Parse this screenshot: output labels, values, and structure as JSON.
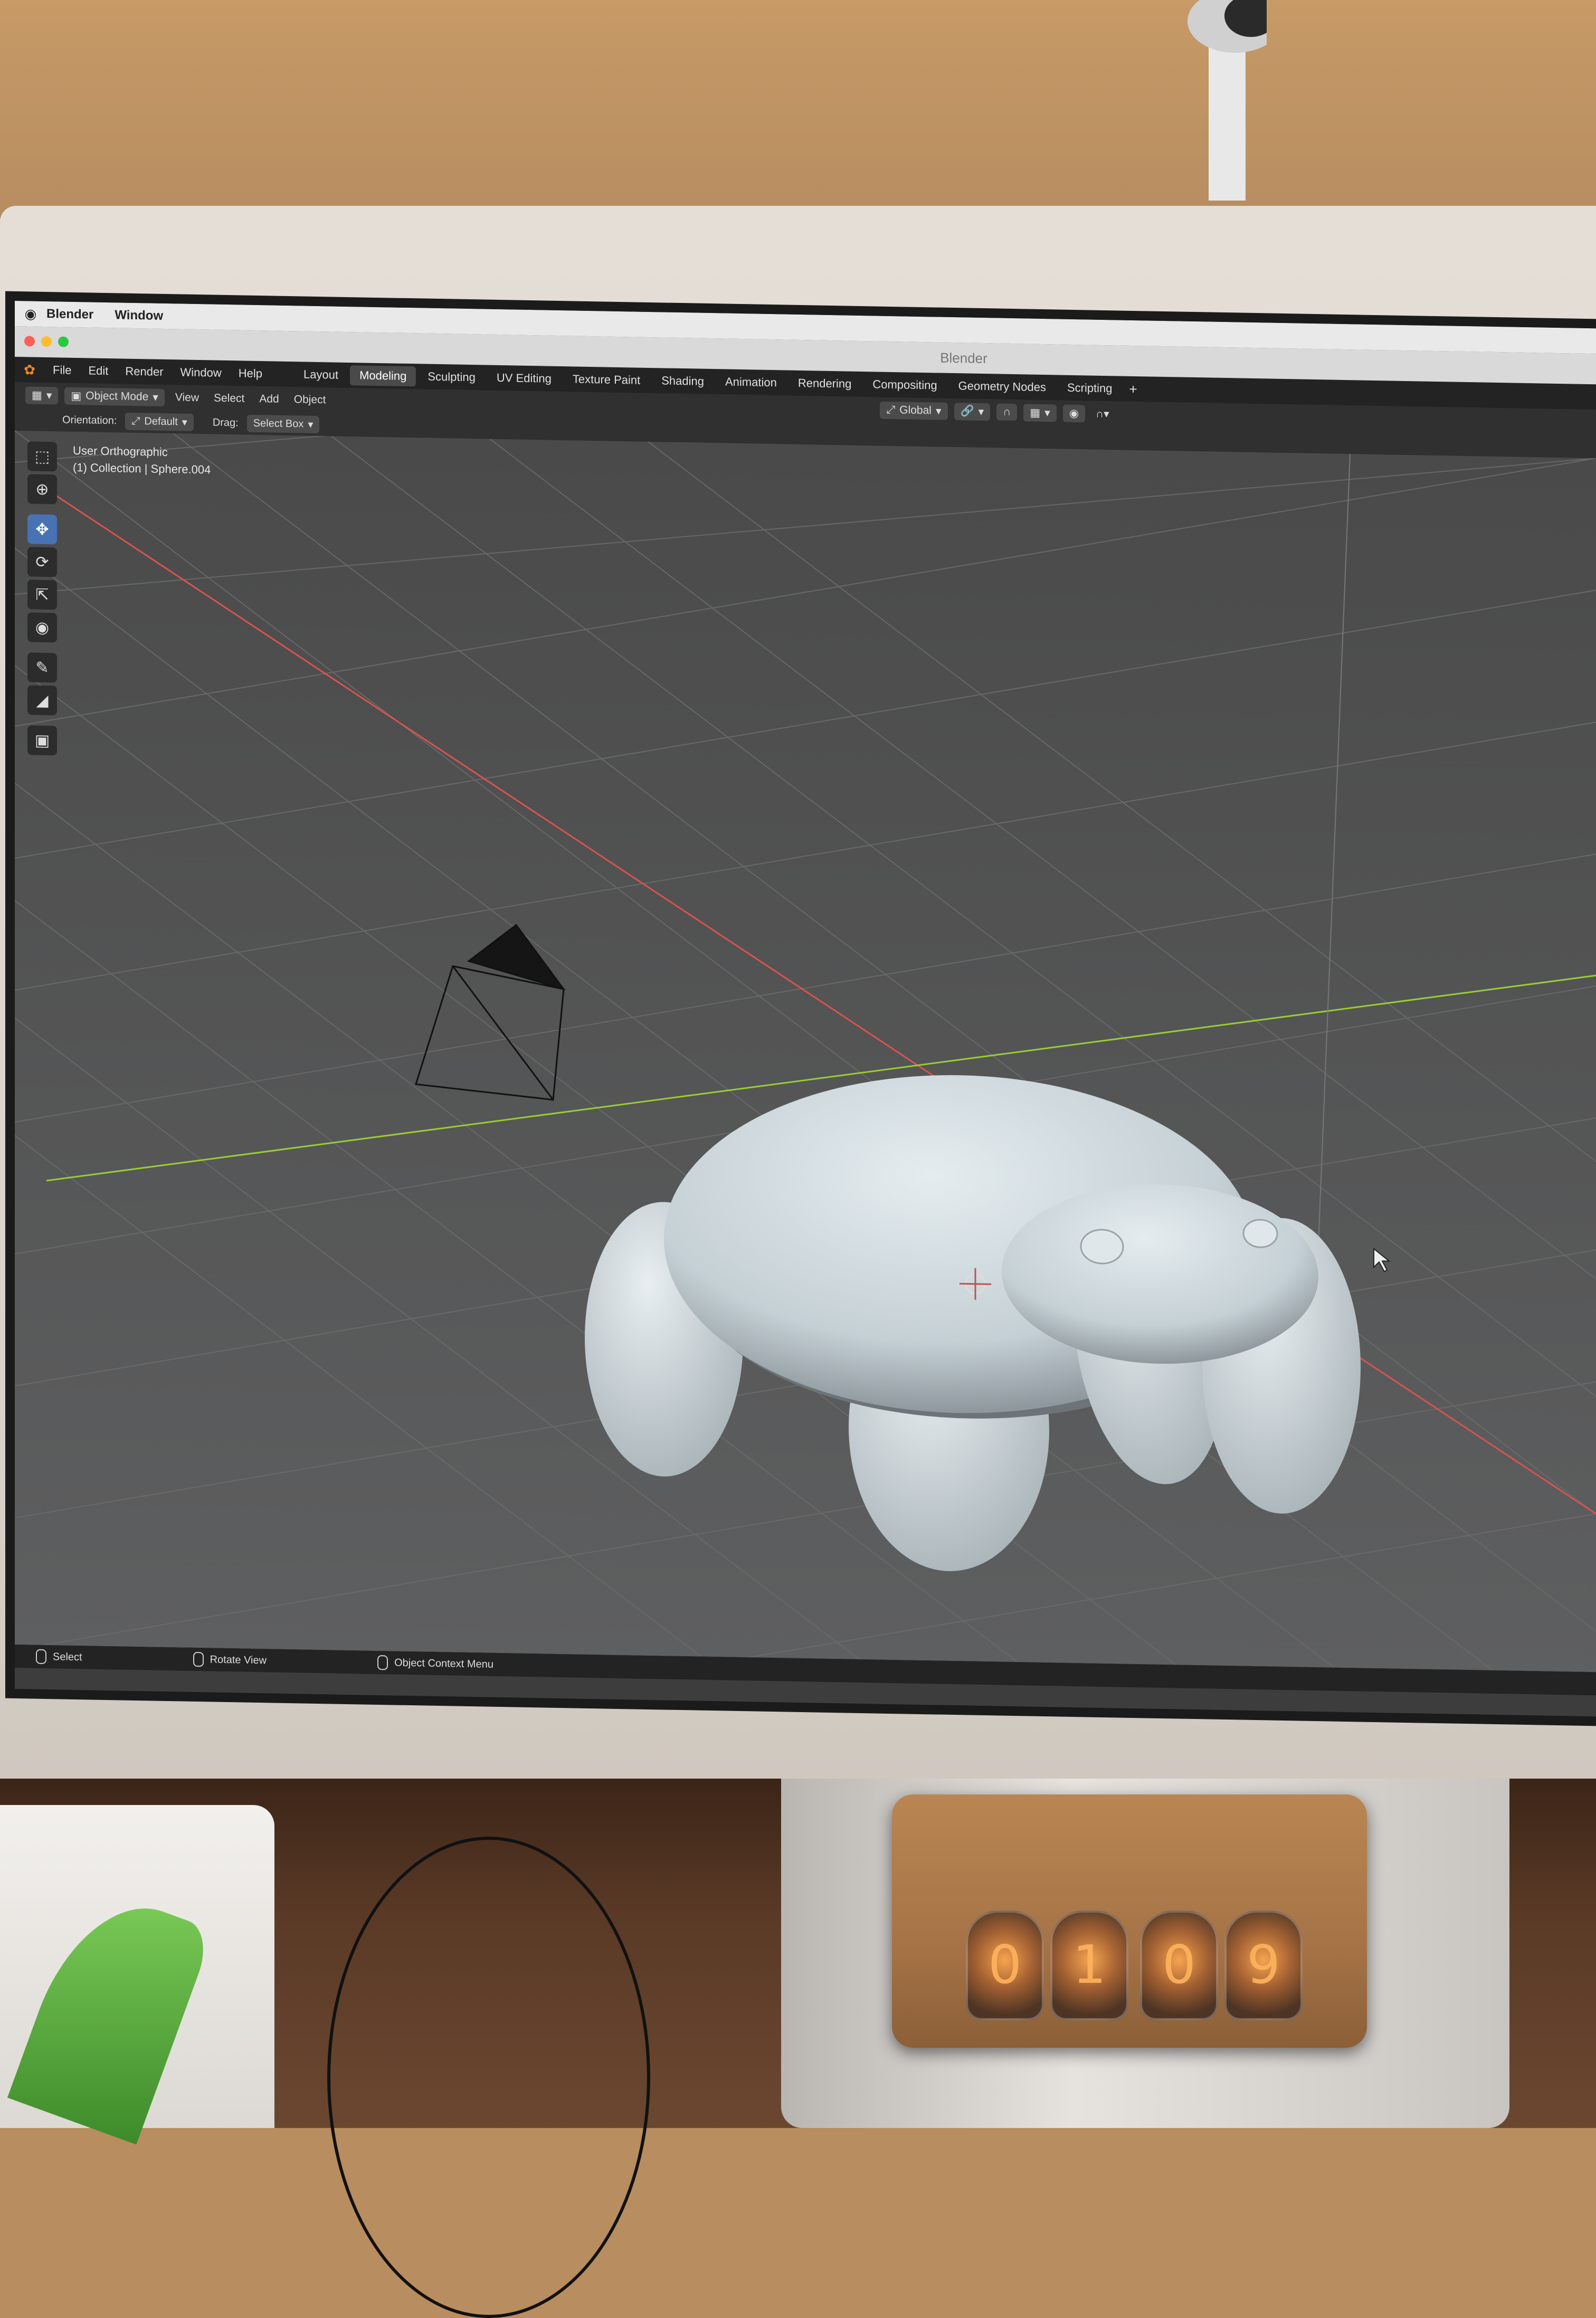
{
  "mac_menu": {
    "apple": "",
    "app": "Blender",
    "window": "Window"
  },
  "window": {
    "title": "Blender"
  },
  "topbar": {
    "menus": [
      "File",
      "Edit",
      "Render",
      "Window",
      "Help"
    ],
    "workspaces": [
      "Layout",
      "Modeling",
      "Sculpting",
      "UV Editing",
      "Texture Paint",
      "Shading",
      "Animation",
      "Rendering",
      "Compositing",
      "Geometry Nodes",
      "Scripting"
    ],
    "active_workspace": "Modeling",
    "add_tab": "+"
  },
  "header": {
    "mode": "Object Mode",
    "menus": [
      "View",
      "Select",
      "Add",
      "Object"
    ],
    "transform_orientation": "Global"
  },
  "tool_settings": {
    "orientation_label": "Orientation:",
    "orientation_value": "Default",
    "drag_label": "Drag:",
    "drag_value": "Select Box"
  },
  "viewport": {
    "view_name": "User Orthographic",
    "collection_info": "(1) Collection | Sphere.004"
  },
  "toolbar": {
    "tools": [
      "select-box",
      "cursor",
      "move",
      "rotate",
      "scale",
      "transform",
      "annotate",
      "measure",
      "add-cube"
    ],
    "active_tool": "move"
  },
  "statusbar": {
    "items": [
      "Select",
      "Rotate View",
      "Object Context Menu"
    ]
  },
  "colors": {
    "accent_active": "#4772b3",
    "x_axis": "#d9534f",
    "y_axis": "#9acd32",
    "mesh": "#c9d3d8",
    "blender_logo": "#f08a24"
  },
  "nixie_clock": {
    "digits": [
      "0",
      "1",
      "0",
      "9"
    ]
  }
}
